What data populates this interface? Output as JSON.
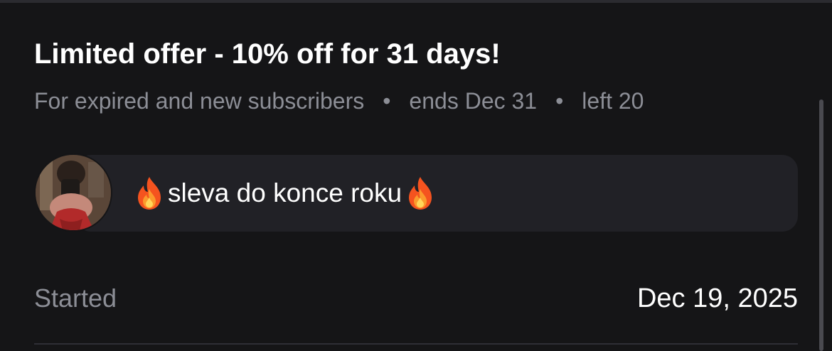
{
  "offer": {
    "title": "Limited offer - 10% off for 31 days!",
    "audience": "For expired and new subscribers",
    "ends": "ends Dec 31",
    "left": "left 20",
    "separator": "•"
  },
  "message": {
    "text": "sleva do konce roku",
    "leading_icon": "fire-icon",
    "trailing_icon": "fire-icon"
  },
  "started": {
    "label": "Started",
    "value": "Dec 19, 2025"
  },
  "colors": {
    "background": "#151517",
    "bubble": "#212126",
    "muted_text": "#8c8e96",
    "primary_text": "#ffffff"
  }
}
